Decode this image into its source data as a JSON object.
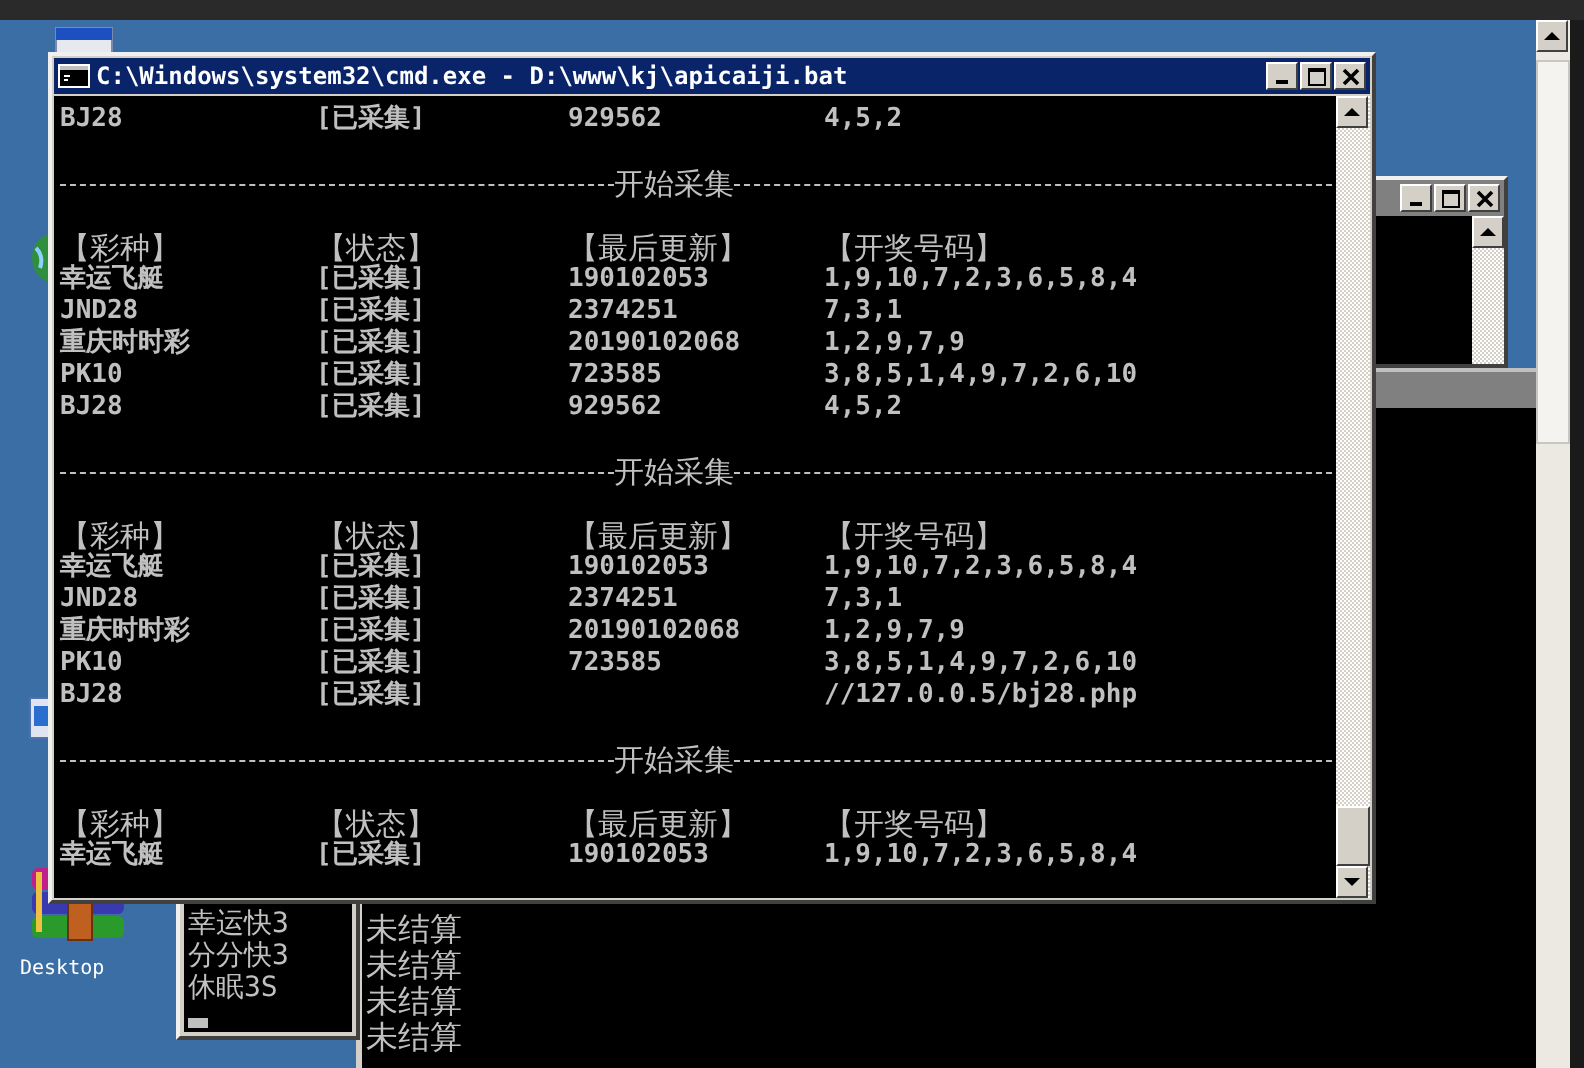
{
  "desktop": {
    "icons": [
      {
        "label": "Desktop"
      }
    ]
  },
  "console_window": {
    "title": "C:\\Windows\\system32\\cmd.exe - D:\\www\\kj\\apicaiji.bat",
    "lines": [
      {
        "kind": "row",
        "lottery": "BJ28",
        "status": "[已采集]",
        "last_update": "929562",
        "numbers": "4,5,2"
      },
      {
        "kind": "separator",
        "text": "开始采集"
      },
      {
        "kind": "header",
        "lottery": "【彩种】",
        "status": "【状态】",
        "last_update": "【最后更新】",
        "numbers": "【开奖号码】"
      },
      {
        "kind": "row",
        "lottery": "幸运飞艇",
        "status": "[已采集]",
        "last_update": "190102053",
        "numbers": "1,9,10,7,2,3,6,5,8,4"
      },
      {
        "kind": "row",
        "lottery": "JND28",
        "status": "[已采集]",
        "last_update": "2374251",
        "numbers": "7,3,1"
      },
      {
        "kind": "row",
        "lottery": "重庆时时彩",
        "status": "[已采集]",
        "last_update": "20190102068",
        "numbers": "1,2,9,7,9"
      },
      {
        "kind": "row",
        "lottery": "PK10",
        "status": "[已采集]",
        "last_update": "723585",
        "numbers": "3,8,5,1,4,9,7,2,6,10"
      },
      {
        "kind": "row",
        "lottery": "BJ28",
        "status": "[已采集]",
        "last_update": "929562",
        "numbers": "4,5,2"
      },
      {
        "kind": "separator",
        "text": "开始采集"
      },
      {
        "kind": "header",
        "lottery": "【彩种】",
        "status": "【状态】",
        "last_update": "【最后更新】",
        "numbers": "【开奖号码】"
      },
      {
        "kind": "row",
        "lottery": "幸运飞艇",
        "status": "[已采集]",
        "last_update": "190102053",
        "numbers": "1,9,10,7,2,3,6,5,8,4"
      },
      {
        "kind": "row",
        "lottery": "JND28",
        "status": "[已采集]",
        "last_update": "2374251",
        "numbers": "7,3,1"
      },
      {
        "kind": "row",
        "lottery": "重庆时时彩",
        "status": "[已采集]",
        "last_update": "20190102068",
        "numbers": "1,2,9,7,9"
      },
      {
        "kind": "row",
        "lottery": "PK10",
        "status": "[已采集]",
        "last_update": "723585",
        "numbers": "3,8,5,1,4,9,7,2,6,10"
      },
      {
        "kind": "row",
        "lottery": "BJ28",
        "status": "[已采集]",
        "numbers": "//127.0.0.5/bj28.php"
      },
      {
        "kind": "separator",
        "text": "开始采集"
      },
      {
        "kind": "header",
        "lottery": "【彩种】",
        "status": "【状态】",
        "last_update": "【最后更新】",
        "numbers": "【开奖号码】"
      },
      {
        "kind": "row",
        "lottery": "幸运飞艇",
        "status": "[已采集]",
        "last_update": "190102053",
        "numbers": "1,9,10,7,2,3,6,5,8,4"
      }
    ]
  },
  "task_console": {
    "lines": [
      "幸运快3",
      "分分快3",
      "休眠3S"
    ]
  },
  "settle_console": {
    "lines": [
      "未结算",
      "未结算",
      "未结算",
      "未结算"
    ]
  }
}
